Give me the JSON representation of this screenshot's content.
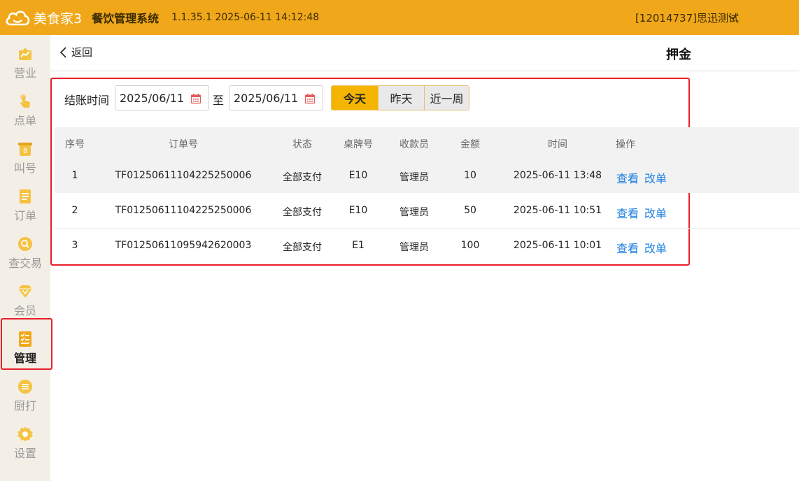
{
  "topbar": {
    "logo_text": "美食家3",
    "app_name": "餐饮管理系统",
    "version": "1.1.35.1 2025-06-11 14:12:48",
    "user": "[12014737]思迅测试",
    "brand_color": "#f0a81a"
  },
  "sidebar": {
    "items": [
      {
        "label": "营业",
        "icon": "chart-icon"
      },
      {
        "label": "点单",
        "icon": "hand-pointer-icon"
      },
      {
        "label": "叫号",
        "icon": "number-icon"
      },
      {
        "label": "订单",
        "icon": "document-icon"
      },
      {
        "label": "查交易",
        "icon": "search-icon"
      },
      {
        "label": "会员",
        "icon": "diamond-icon"
      },
      {
        "label": "管理",
        "icon": "checklist-icon",
        "active": true
      },
      {
        "label": "厨打",
        "icon": "list-icon"
      },
      {
        "label": "设置",
        "icon": "gear-icon"
      }
    ]
  },
  "header": {
    "back_label": "返回",
    "title": "押金"
  },
  "filter": {
    "label": "结账时间",
    "start_date": "2025/06/11",
    "separator": "至",
    "end_date": "2025/06/11",
    "quick_ranges": [
      "今天",
      "昨天",
      "近一周"
    ],
    "selected_range": "今天"
  },
  "table": {
    "columns": [
      "序号",
      "订单号",
      "状态",
      "桌牌号",
      "收款员",
      "金额",
      "时间",
      "操作"
    ],
    "rows": [
      {
        "no": "1",
        "order": "TF01250611104225250006",
        "status": "全部支付",
        "table": "E10",
        "cashier": "管理员",
        "amount": "10",
        "time": "2025-06-11 13:48"
      },
      {
        "no": "2",
        "order": "TF01250611104225250006",
        "status": "全部支付",
        "table": "E10",
        "cashier": "管理员",
        "amount": "50",
        "time": "2025-06-11 10:51"
      },
      {
        "no": "3",
        "order": "TF01250611095942620003",
        "status": "全部支付",
        "table": "E1",
        "cashier": "管理员",
        "amount": "100",
        "time": "2025-06-11 10:01"
      }
    ],
    "actions": {
      "view": "查看",
      "edit": "改单"
    }
  }
}
